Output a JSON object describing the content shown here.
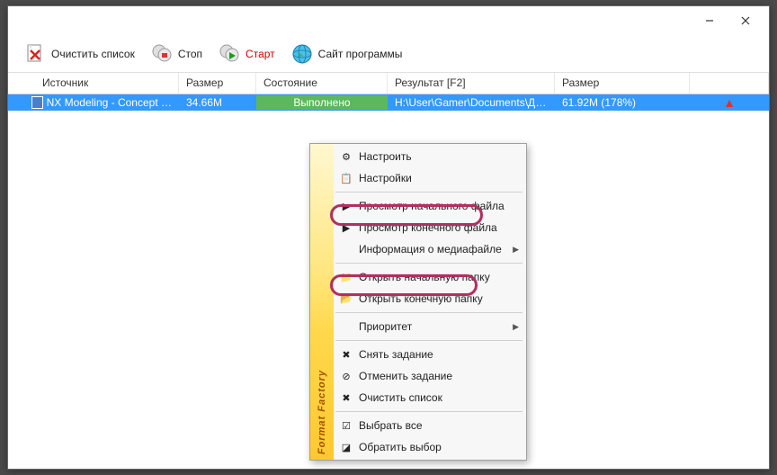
{
  "titlebar": {},
  "toolbar": {
    "clear": "Очистить список",
    "stop": "Стоп",
    "start": "Старт",
    "site": "Сайт программы"
  },
  "columns": {
    "source": "Источник",
    "size": "Размер",
    "status": "Состояние",
    "result": "Результат [F2]",
    "size2": "Размер"
  },
  "row": {
    "source": "NX Modeling - Concept …",
    "size": "34.66M",
    "status": "Выполнено",
    "result": "H:\\User\\Gamer\\Documents\\До…",
    "size2": "61.92M  (178%)"
  },
  "menu": {
    "gutter": "Format Factory",
    "configure": "Настроить",
    "settings": "Настройки",
    "view_source_file": "Просмотр начального файла",
    "view_output_file": "Просмотр конечного файла",
    "media_info": "Информация о медиафайле",
    "open_source_folder": "Открыть начальную папку",
    "open_output_folder": "Открыть конечную папку",
    "priority": "Приоритет",
    "remove_task": "Снять задание",
    "cancel_task": "Отменить задание",
    "clear_list": "Очистить список",
    "select_all": "Выбрать все",
    "invert_selection": "Обратить выбор"
  }
}
